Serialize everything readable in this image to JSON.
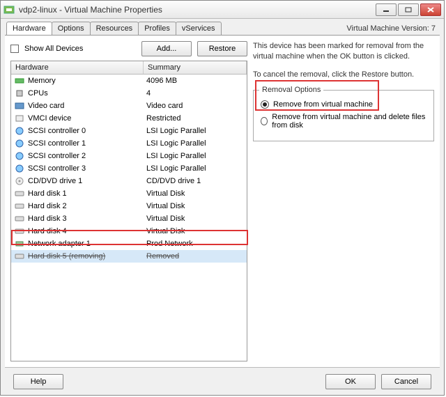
{
  "window": {
    "title": "vdp2-linux - Virtual Machine Properties",
    "version_label": "Virtual Machine Version: 7"
  },
  "tabs": [
    {
      "label": "Hardware",
      "active": true
    },
    {
      "label": "Options",
      "active": false
    },
    {
      "label": "Resources",
      "active": false
    },
    {
      "label": "Profiles",
      "active": false
    },
    {
      "label": "vServices",
      "active": false
    }
  ],
  "left": {
    "show_all_label": "Show All Devices",
    "add_button": "Add...",
    "restore_button": "Restore",
    "columns": {
      "hardware": "Hardware",
      "summary": "Summary"
    },
    "items": [
      {
        "icon": "memory-icon",
        "name": "Memory",
        "summary": "4096 MB"
      },
      {
        "icon": "cpu-icon",
        "name": "CPUs",
        "summary": "4"
      },
      {
        "icon": "video-icon",
        "name": "Video card",
        "summary": "Video card"
      },
      {
        "icon": "vmci-icon",
        "name": "VMCI device",
        "summary": "Restricted"
      },
      {
        "icon": "scsi-icon",
        "name": "SCSI controller 0",
        "summary": "LSI Logic Parallel"
      },
      {
        "icon": "scsi-icon",
        "name": "SCSI controller 1",
        "summary": "LSI Logic Parallel"
      },
      {
        "icon": "scsi-icon",
        "name": "SCSI controller 2",
        "summary": "LSI Logic Parallel"
      },
      {
        "icon": "scsi-icon",
        "name": "SCSI controller 3",
        "summary": "LSI Logic Parallel"
      },
      {
        "icon": "cdrom-icon",
        "name": "CD/DVD drive 1",
        "summary": "CD/DVD drive 1"
      },
      {
        "icon": "disk-icon",
        "name": "Hard disk 1",
        "summary": "Virtual Disk"
      },
      {
        "icon": "disk-icon",
        "name": "Hard disk 2",
        "summary": "Virtual Disk"
      },
      {
        "icon": "disk-icon",
        "name": "Hard disk 3",
        "summary": "Virtual Disk"
      },
      {
        "icon": "disk-icon",
        "name": "Hard disk 4",
        "summary": "Virtual Disk"
      },
      {
        "icon": "nic-icon",
        "name": "Network adapter 1",
        "summary": "Prod Network"
      },
      {
        "icon": "disk-icon",
        "name": "Hard disk 5 (removing)",
        "summary": "Removed",
        "selected": true,
        "removing": true
      }
    ]
  },
  "right": {
    "desc1": "This device has been marked for removal from the virtual machine when the OK button is clicked.",
    "desc2": "To cancel the removal, click the Restore button.",
    "group_title": "Removal Options",
    "radio1": "Remove from virtual machine",
    "radio2": "Remove from virtual machine and delete files from disk",
    "selected_radio": 1
  },
  "buttons": {
    "help": "Help",
    "ok": "OK",
    "cancel": "Cancel"
  }
}
